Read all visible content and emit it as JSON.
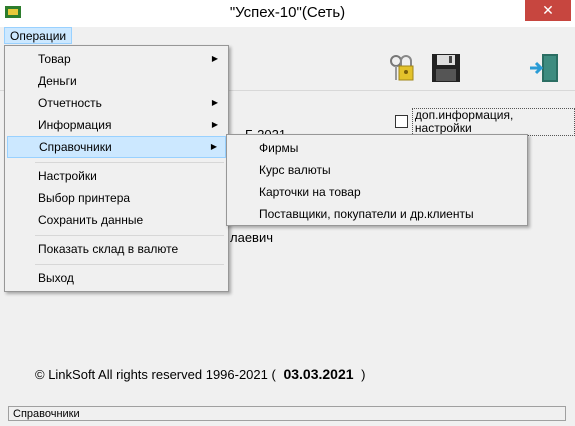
{
  "window": {
    "title": "\"Успех-10\"(Сеть)",
    "close_glyph": "✕"
  },
  "menubar": {
    "operations_label": "Операции"
  },
  "main_menu": {
    "items": [
      {
        "label": "Товар",
        "has_submenu": true
      },
      {
        "label": "Деньги",
        "has_submenu": false
      },
      {
        "label": "Отчетность",
        "has_submenu": true
      },
      {
        "label": "Информация",
        "has_submenu": true
      },
      {
        "label": "Справочники",
        "has_submenu": true
      },
      {
        "label": "Настройки",
        "has_submenu": false
      },
      {
        "label": "Выбор принтера",
        "has_submenu": false
      },
      {
        "label": "Сохранить данные",
        "has_submenu": false
      },
      {
        "label": "Показать склад в валюте",
        "has_submenu": false
      },
      {
        "label": "Выход",
        "has_submenu": false
      }
    ],
    "arrow_glyph": "▶"
  },
  "submenu": {
    "items": [
      {
        "label": "Фирмы"
      },
      {
        "label": "Курс валюты"
      },
      {
        "label": "Карточки на товар"
      },
      {
        "label": "Поставщики, покупатели и др.клиенты"
      }
    ]
  },
  "options": {
    "checkbox_label": "доп.информация, настройки",
    "checked": false
  },
  "background_text": {
    "partial_year": "Б    2021",
    "partial_name": "лаевич"
  },
  "footer": {
    "copyright_prefix": "©  LinkSoft All rights reserved 1996-2021 (",
    "date": "03.03.2021",
    "copyright_suffix": ")"
  },
  "statusbar": {
    "text": "Справочники"
  },
  "colors": {
    "menu_highlight": "#cce8ff",
    "close_button": "#c7463f",
    "surface": "#f0f0f0"
  },
  "icons": [
    "app-icon",
    "keys-lock-icon",
    "floppy-disk-icon",
    "exit-door-icon"
  ]
}
